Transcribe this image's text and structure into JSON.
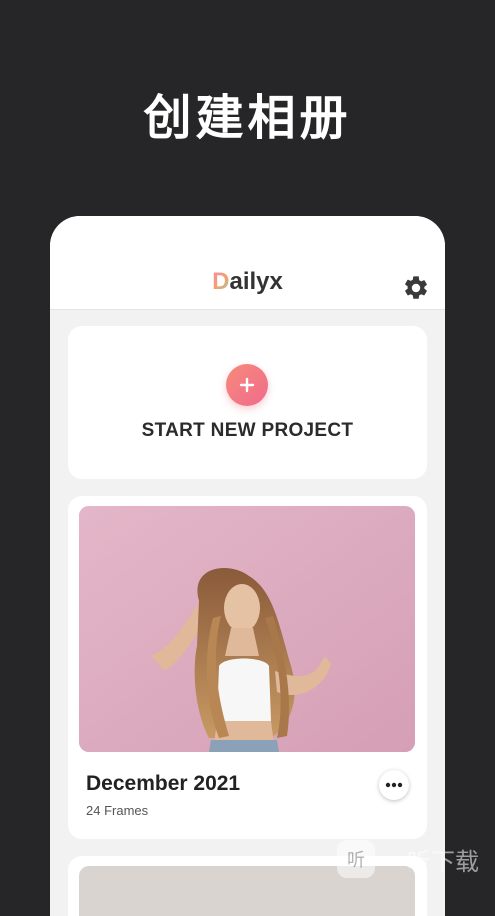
{
  "promo": {
    "title": "创建相册"
  },
  "app": {
    "logo_first": "D",
    "logo_rest": "ailyx",
    "settings_icon": "gear-icon"
  },
  "new_project": {
    "icon": "plus-icon",
    "label": "START NEW PROJECT"
  },
  "albums": [
    {
      "title": "December 2021",
      "meta": "24 Frames",
      "menu_icon": "more-horizontal-icon"
    }
  ],
  "watermark": {
    "logo": "听",
    "text": "一听下载"
  },
  "colors": {
    "background": "#262527",
    "accent_start": "#f58a7a",
    "accent_end": "#f16b8c",
    "photo_backdrop": "#dcaabe"
  }
}
